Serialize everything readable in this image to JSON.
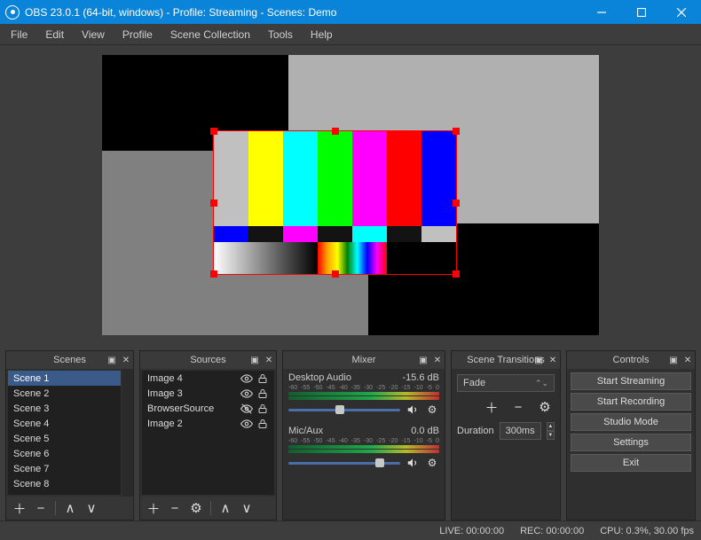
{
  "window": {
    "title": "OBS 23.0.1 (64-bit, windows) - Profile: Streaming - Scenes: Demo"
  },
  "menu": [
    "File",
    "Edit",
    "View",
    "Profile",
    "Scene Collection",
    "Tools",
    "Help"
  ],
  "docks": {
    "scenes": {
      "title": "Scenes",
      "items": [
        "Scene 1",
        "Scene 2",
        "Scene 3",
        "Scene 4",
        "Scene 5",
        "Scene 6",
        "Scene 7",
        "Scene 8"
      ],
      "selected": 0
    },
    "sources": {
      "title": "Sources",
      "items": [
        {
          "name": "Image 4",
          "visible": true,
          "locked": true
        },
        {
          "name": "Image 3",
          "visible": true,
          "locked": true
        },
        {
          "name": "BrowserSource",
          "visible": false,
          "locked": true
        },
        {
          "name": "Image 2",
          "visible": true,
          "locked": true
        }
      ]
    },
    "mixer": {
      "title": "Mixer",
      "channels": [
        {
          "name": "Desktop Audio",
          "level": "-15.6 dB",
          "slider": 0.42
        },
        {
          "name": "Mic/Aux",
          "level": "0.0 dB",
          "slider": 0.78
        }
      ],
      "ticks": [
        "-60",
        "-55",
        "-50",
        "-45",
        "-40",
        "-35",
        "-30",
        "-25",
        "-20",
        "-15",
        "-10",
        "-5",
        "0"
      ]
    },
    "transitions": {
      "title": "Scene Transitions",
      "current": "Fade",
      "duration_label": "Duration",
      "duration": "300ms"
    },
    "controls": {
      "title": "Controls",
      "buttons": [
        "Start Streaming",
        "Start Recording",
        "Studio Mode",
        "Settings",
        "Exit"
      ]
    }
  },
  "status": {
    "live": "LIVE: 00:00:00",
    "rec": "REC: 00:00:00",
    "cpu": "CPU: 0.3%, 30.00 fps"
  }
}
